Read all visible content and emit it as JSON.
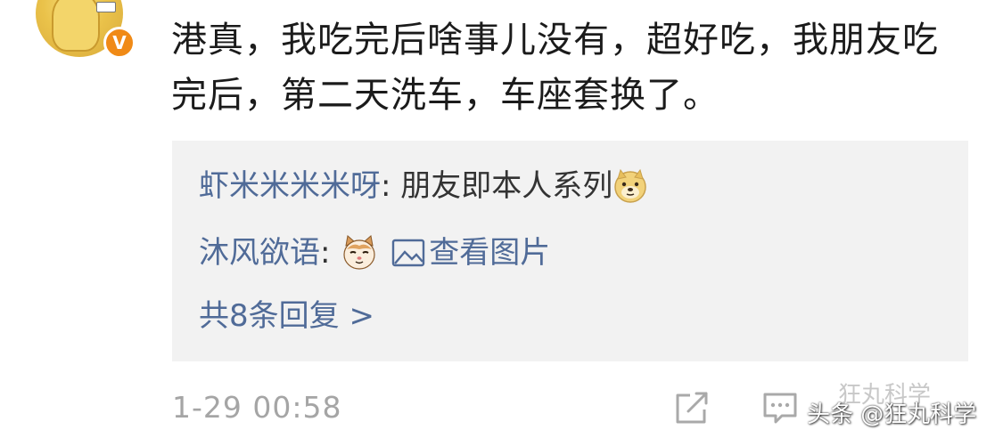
{
  "comment": {
    "text": "港真，我吃完后啥事儿没有，超好吃，我朋友吃完后，第二天洗车，车座套换了。",
    "verified_badge": "V"
  },
  "replies": [
    {
      "username": "虾米米米米呀",
      "separator": ": ",
      "text": "朋友即本人系列",
      "emoji": "doge-emoji"
    },
    {
      "username": "沐风欲语",
      "separator": ": ",
      "emoji": "cat-emoji",
      "view_image_label": "查看图片"
    }
  ],
  "more_replies_label": "共8条回复 >",
  "footer": {
    "timestamp": "1-29 00:58",
    "watermark": "头条 @狂丸科学",
    "watermark_ghost": "狂丸科学"
  },
  "colors": {
    "username": "#506b98",
    "reply_box": "#f2f2f2",
    "timestamp": "#a5a5a5",
    "badge": "#f08a16"
  }
}
